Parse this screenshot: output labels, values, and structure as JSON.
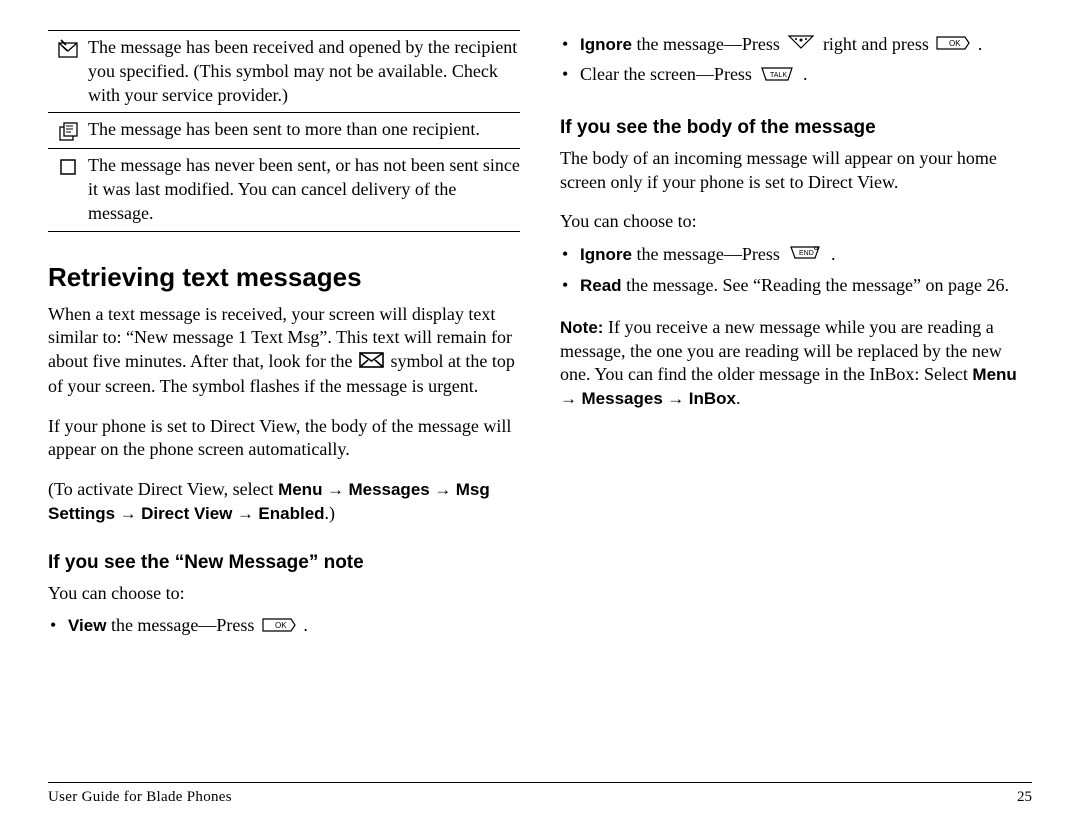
{
  "left": {
    "table": [
      {
        "icon": "opened-envelope",
        "text": "The message has been received and opened by the recipient you specified. (This symbol may not be available. Check with your service provider.)"
      },
      {
        "icon": "multi-recipient",
        "text": "The message has been sent to more than one recipient."
      },
      {
        "icon": "never-sent",
        "text": "The message has never been sent, or has not been sent since it was last modified. You can cancel delivery of the message."
      }
    ],
    "heading": "Retrieving text messages",
    "para1a": "When a text message is received, your screen will display text similar to: “New message 1 Text Msg”. This text will remain for about five minutes. After that, look for the ",
    "para1b": " symbol at the top of your screen. The symbol flashes if the message is urgent.",
    "para2": "If your phone is set to Direct View, the body of the message will appear on the phone screen automatically.",
    "para3a": "(To activate Direct View, select ",
    "path": {
      "menu": "Menu",
      "messages": "Messages",
      "msgsettings": "Msg Settings",
      "directview": "Direct View",
      "enabled": "Enabled"
    },
    "para3b": ".)",
    "sub1": "If you see the “New Message” note",
    "sub1_lead": "You can choose to:",
    "view_label": "View",
    "view_rest": " the message—Press "
  },
  "right": {
    "ignore_label": "Ignore",
    "ignore_rest1": " the message—Press ",
    "ignore_rest2": " right and press ",
    "clear_text": "Clear the screen—Press ",
    "sub2": "If you see the body of the message",
    "sub2_para": "The body of an incoming message will appear on your home screen only if your phone is set to Direct View.",
    "sub2_lead": "You can choose to:",
    "ignore2_label": "Ignore",
    "ignore2_rest": " the message—Press ",
    "read_label": "Read",
    "read_rest": " the message. See “Reading the message” on page 26.",
    "note_label": "Note:",
    "note_text": "  If you receive a new message while you are reading a message, the one you are reading will be replaced by the new one. You can find the older message in the InBox: Select ",
    "note_path": {
      "menu": "Menu",
      "messages": "Messages",
      "inbox": "InBox"
    },
    "note_end": "."
  },
  "footer": {
    "left": "User Guide for Blade Phones",
    "right": "25"
  },
  "arrow": "→"
}
